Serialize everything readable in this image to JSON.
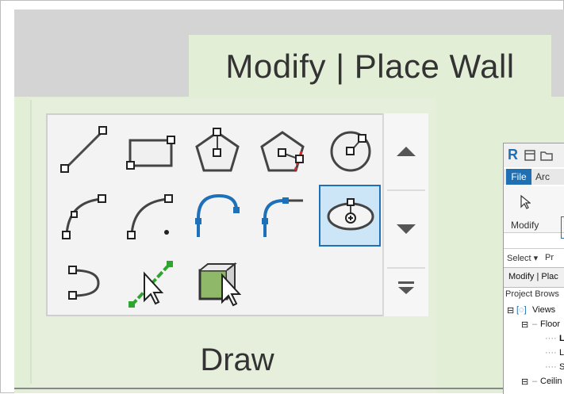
{
  "ribbon": {
    "contextual_tab": "Modify | Place Wall",
    "panel_label": "Draw"
  },
  "tools": [
    {
      "name": "line-tool-icon",
      "selected": false
    },
    {
      "name": "rectangle-tool-icon",
      "selected": false
    },
    {
      "name": "inscribed-polygon-tool-icon",
      "selected": false
    },
    {
      "name": "circumscribed-polygon-tool-icon",
      "selected": false
    },
    {
      "name": "circle-tool-icon",
      "selected": false
    },
    {
      "name": "start-end-radius-arc-tool-icon",
      "selected": false
    },
    {
      "name": "center-ends-arc-tool-icon",
      "selected": false
    },
    {
      "name": "tangent-end-arc-tool-icon",
      "selected": false
    },
    {
      "name": "fillet-arc-tool-icon",
      "selected": false
    },
    {
      "name": "ellipse-tool-icon",
      "selected": true
    },
    {
      "name": "partial-ellipse-tool-icon",
      "selected": false
    },
    {
      "name": "pick-lines-tool-icon",
      "selected": false
    },
    {
      "name": "pick-faces-tool-icon",
      "selected": false
    }
  ],
  "inset": {
    "app_logo": "R",
    "tab_file": "File",
    "tab_arch": "Arc",
    "modify_label": "Modify",
    "select_label": "Select ▾",
    "properties_label": "Pr",
    "context_label": "Modify | Plac",
    "browser_label": "Project Brows",
    "tree": [
      "Views",
      "Floor",
      "L",
      "L",
      "S",
      "Ceilin"
    ]
  },
  "colors": {
    "accent_blue": "#1e70b8",
    "selected_bg": "#cde6f7",
    "ribbon_green": "#e3eed7",
    "pick_green": "#2fa52f"
  }
}
